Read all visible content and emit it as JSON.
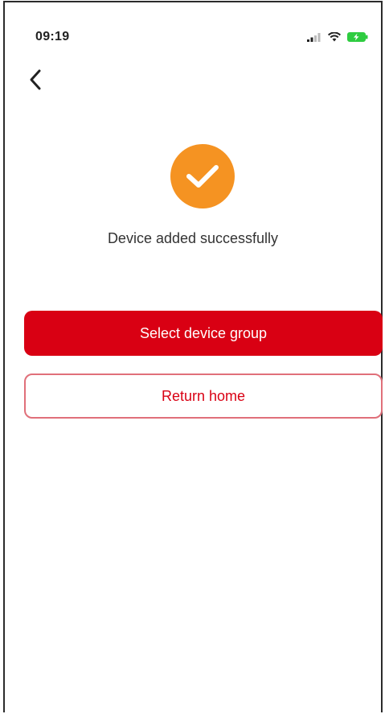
{
  "status_bar": {
    "time": "09:19",
    "icons": [
      "signal-icon",
      "wifi-icon",
      "battery-charging-icon"
    ],
    "battery_color": "#2ecc40"
  },
  "nav": {
    "back_icon": "chevron-left-icon"
  },
  "result": {
    "icon": "check-circle-icon",
    "icon_color": "#f59322",
    "message": "Device added successfully"
  },
  "actions": {
    "primary_label": "Select device group",
    "primary_color": "#d90013",
    "secondary_label": "Return home",
    "secondary_color": "#d90013"
  }
}
